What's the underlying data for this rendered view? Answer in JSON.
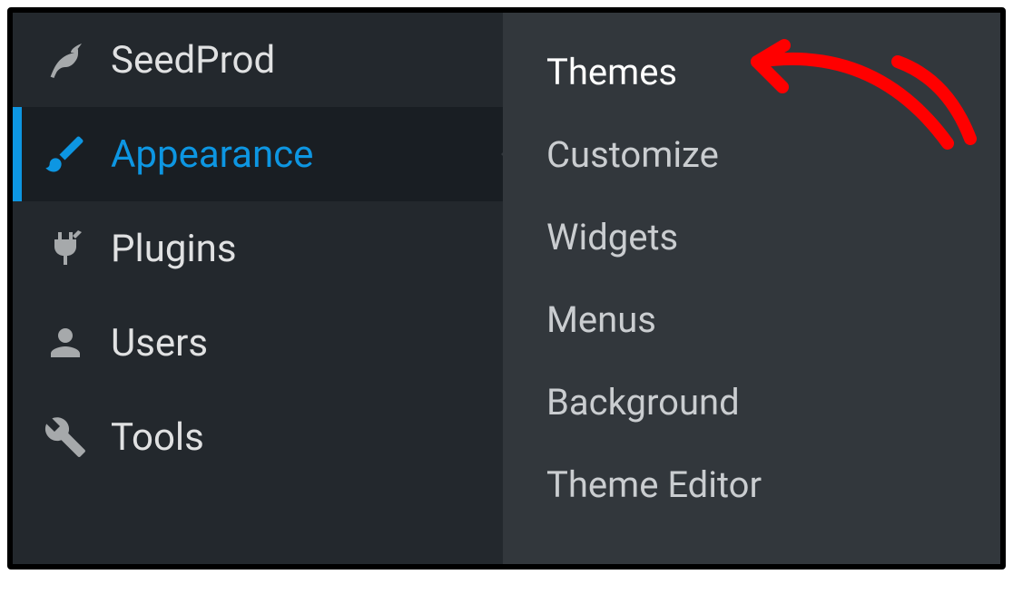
{
  "sidebar": {
    "items": [
      {
        "label": "SeedProd",
        "icon": "leaf-icon",
        "active": false
      },
      {
        "label": "Appearance",
        "icon": "paintbrush-icon",
        "active": true
      },
      {
        "label": "Plugins",
        "icon": "plug-icon",
        "active": false
      },
      {
        "label": "Users",
        "icon": "user-icon",
        "active": false
      },
      {
        "label": "Tools",
        "icon": "wrench-icon",
        "active": false
      }
    ]
  },
  "submenu": {
    "items": [
      {
        "label": "Themes",
        "highlight": true
      },
      {
        "label": "Customize",
        "highlight": false
      },
      {
        "label": "Widgets",
        "highlight": false
      },
      {
        "label": "Menus",
        "highlight": false
      },
      {
        "label": "Background",
        "highlight": false
      },
      {
        "label": "Theme Editor",
        "highlight": false
      }
    ]
  },
  "annotation": {
    "type": "arrow",
    "color": "#ff0000",
    "target": "themes"
  }
}
